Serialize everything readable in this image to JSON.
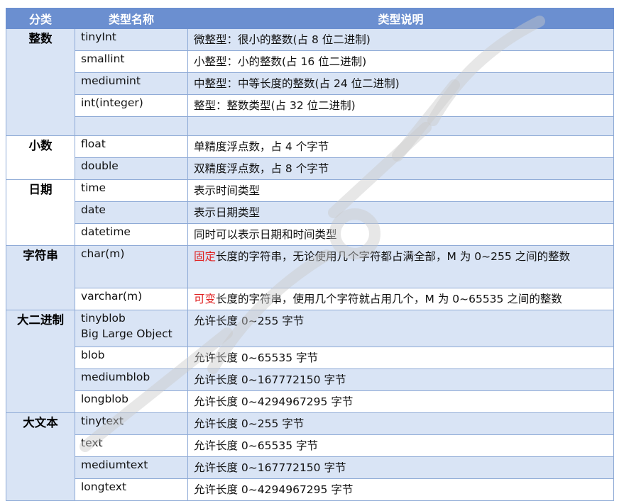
{
  "header": {
    "col_category": "分类",
    "col_name": "类型名称",
    "col_desc": "类型说明"
  },
  "groups": [
    {
      "category": "整数",
      "rows": [
        {
          "name": "tinyInt",
          "desc": "微整型：很小的整数(占 8 位二进制)"
        },
        {
          "name": "smallint",
          "desc": "小整型：小的整数(占 16 位二进制)"
        },
        {
          "name": "mediumint",
          "desc": "中整型：中等长度的整数(占 24 位二进制)"
        },
        {
          "name": "int(integer)",
          "desc": "整型：整数类型(占 32 位二进制)"
        },
        {
          "name": "",
          "desc": ""
        }
      ]
    },
    {
      "category": "小数",
      "rows": [
        {
          "name": "float",
          "desc": "单精度浮点数，占 4 个字节"
        },
        {
          "name": "double",
          "desc": "双精度浮点数，占 8 个字节"
        }
      ]
    },
    {
      "category": "日期",
      "rows": [
        {
          "name": "time",
          "desc": "表示时间类型"
        },
        {
          "name": "date",
          "desc": "表示日期类型"
        },
        {
          "name": "datetime",
          "desc": "同时可以表示日期和时间类型"
        }
      ]
    },
    {
      "category": "字符串",
      "rows": [
        {
          "name": "char(m)",
          "desc_highlight": "固定",
          "desc": "长度的字符串，无论使用几个字符都占满全部，M 为 0~255 之间的整数"
        },
        {
          "name": "varchar(m)",
          "desc_highlight": "可变",
          "desc": "长度的字符串，使用几个字符就占用几个，M 为 0~65535 之间的整数"
        }
      ]
    },
    {
      "category": "大二进制",
      "rows": [
        {
          "name": "tinyblob",
          "name_sub": "Big Large Object",
          "desc": "允许长度 0~255 字节"
        },
        {
          "name": "blob",
          "desc": "允许长度 0~65535 字节"
        },
        {
          "name": "mediumblob",
          "desc": "允许长度 0~167772150 字节"
        },
        {
          "name": "longblob",
          "desc": "允许长度 0~4294967295 字节"
        }
      ]
    },
    {
      "category": "大文本",
      "rows": [
        {
          "name": "tinytext",
          "desc": "允许长度 0~255 字节"
        },
        {
          "name": "text",
          "desc": "允许长度 0~65535 字节"
        },
        {
          "name": "mediumtext",
          "desc": "允许长度 0~167772150 字节"
        },
        {
          "name": "longtext",
          "desc": "允许长度 0~4294967295 字节"
        }
      ]
    }
  ],
  "colors": {
    "header_bg": "#6b8fd0",
    "row_shade": "#d9e4f5",
    "border": "#8eaad6",
    "highlight": "#e02020"
  }
}
